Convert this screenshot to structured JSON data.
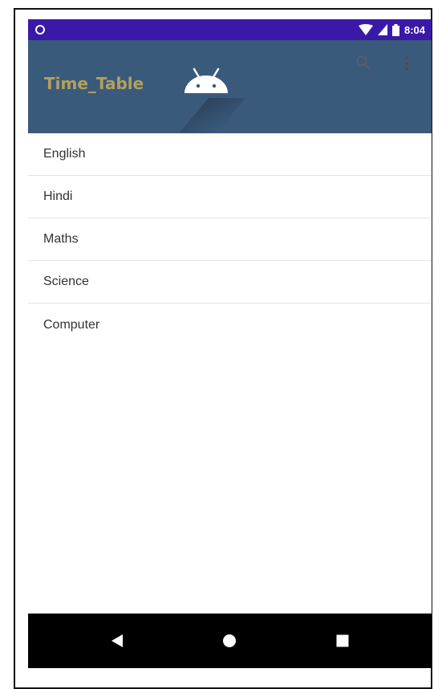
{
  "status_bar": {
    "time": "8:04",
    "icons": [
      "notification-circle-icon",
      "wifi-icon",
      "signal-icon",
      "battery-icon"
    ],
    "color": "#3b19a8"
  },
  "app_bar": {
    "title": "Time_Table",
    "logo": "android-logo-icon",
    "actions": [
      "search-icon",
      "more-options-icon"
    ],
    "color": "#3a5a7c",
    "title_color": "#b3a05c"
  },
  "subjects": [
    {
      "label": "English"
    },
    {
      "label": "Hindi"
    },
    {
      "label": "Maths"
    },
    {
      "label": "Science"
    },
    {
      "label": "Computer"
    }
  ],
  "nav_bar": {
    "buttons": [
      "back-icon",
      "home-icon",
      "recents-icon"
    ]
  }
}
